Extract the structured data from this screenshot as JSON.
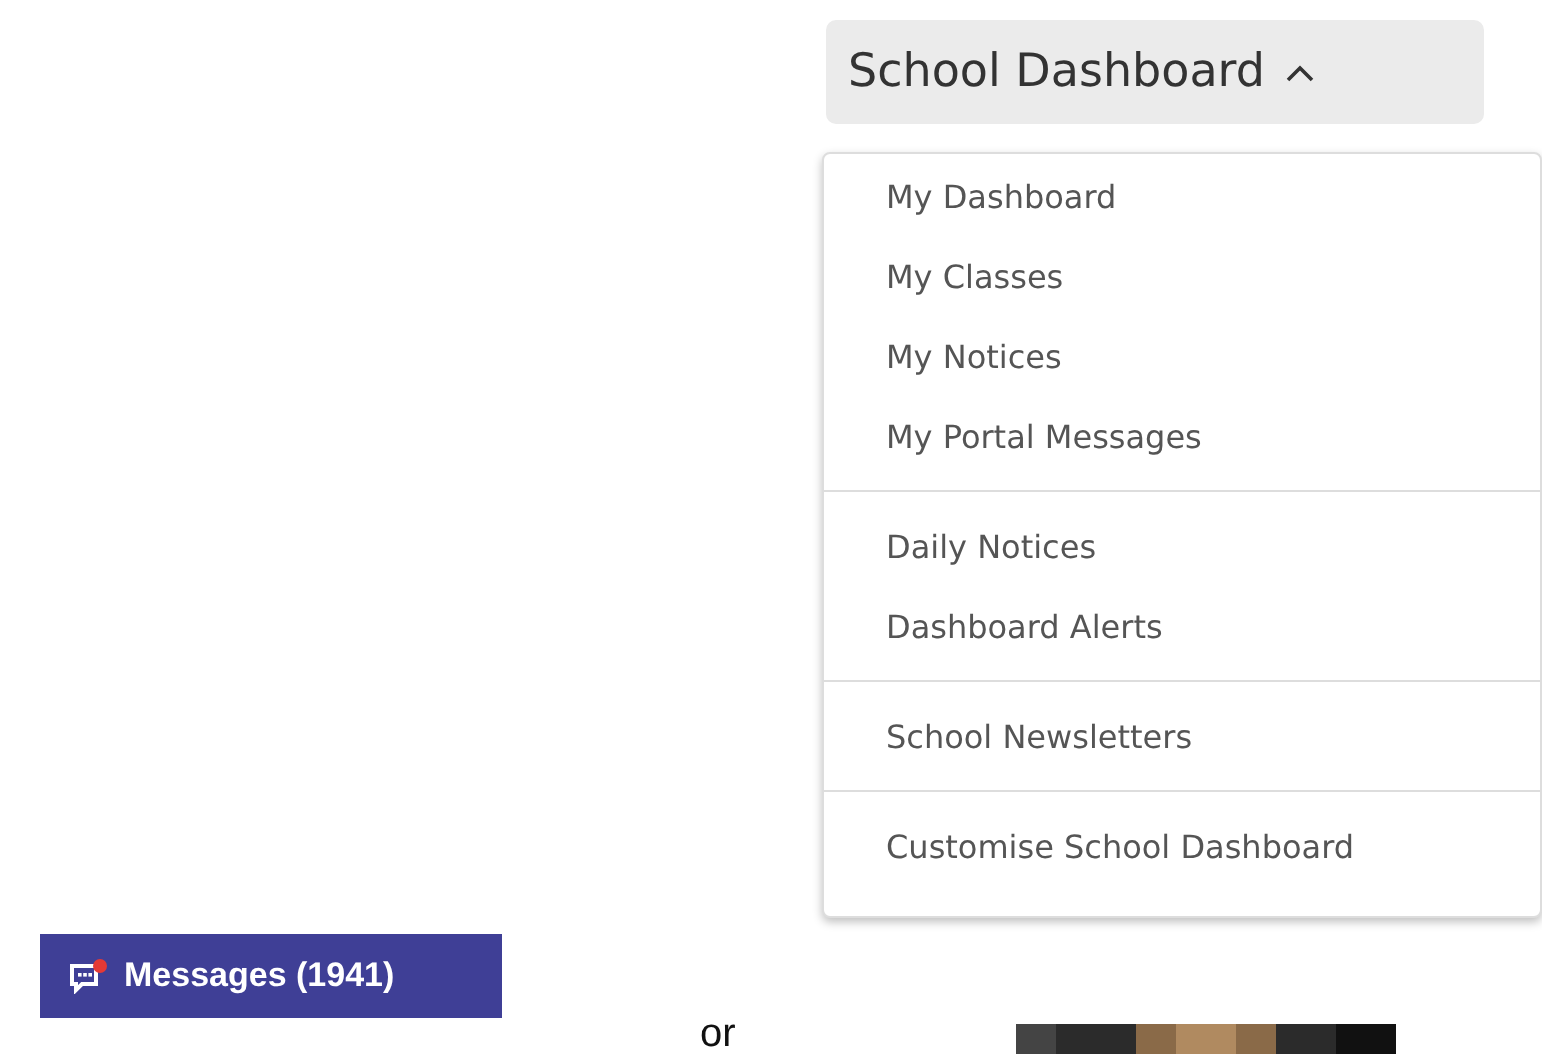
{
  "messages_button": {
    "label": "Messages (1941)",
    "unread": true
  },
  "separator_text": "or",
  "dashboard_menu": {
    "label": "School Dashboard",
    "expanded": true,
    "sections": [
      {
        "items": [
          "My Dashboard",
          "My Classes",
          "My Notices",
          "My Portal Messages"
        ]
      },
      {
        "items": [
          "Daily Notices",
          "Dashboard Alerts"
        ]
      },
      {
        "items": [
          "School Newsletters"
        ]
      },
      {
        "items": [
          "Customise School Dashboard"
        ]
      }
    ]
  }
}
